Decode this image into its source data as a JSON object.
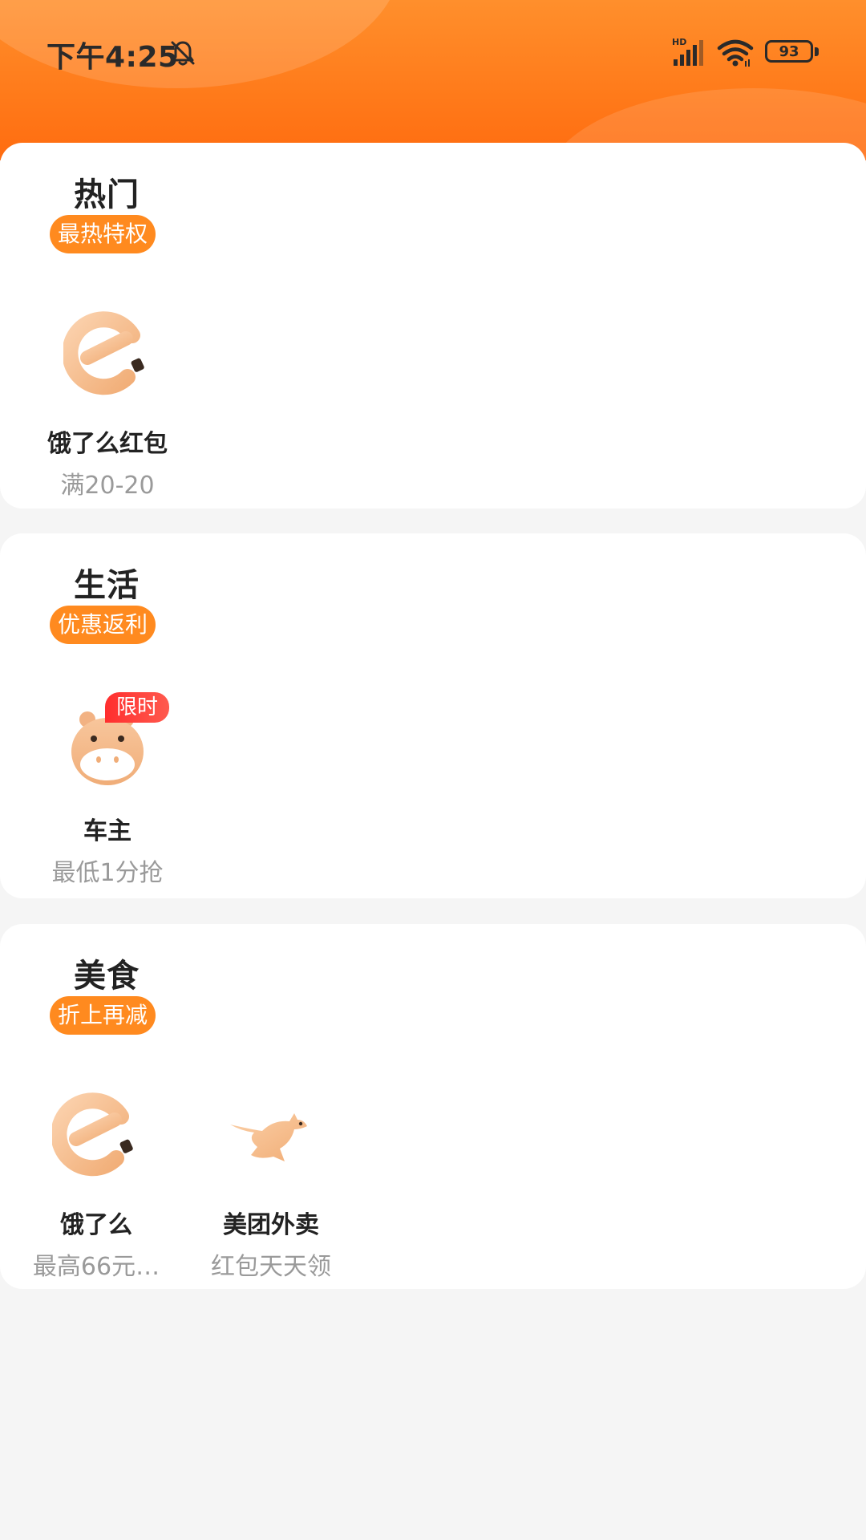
{
  "status_bar": {
    "time": "下午4:25",
    "battery": "93",
    "icons": [
      "bell-off-icon",
      "signal-hd-icon",
      "wifi-icon",
      "battery-icon"
    ]
  },
  "colors": {
    "header_orange": "#ff7a1a",
    "badge_orange": "#ff8a1f",
    "limited_red": "#ff2e2e",
    "icon_peach": "#f5b98a"
  },
  "sections": [
    {
      "title": "热门",
      "badge": "最热特权",
      "items": [
        {
          "name": "饿了么红包",
          "sub": "满20-20",
          "icon": "eleme-icon"
        }
      ]
    },
    {
      "title": "生活",
      "badge": "优惠返利",
      "items": [
        {
          "name": "车主",
          "sub": "最低1分抢",
          "icon": "hippo-icon",
          "tag": "限时"
        }
      ]
    },
    {
      "title": "美食",
      "badge": "折上再减",
      "items": [
        {
          "name": "饿了么",
          "sub": "最高66元…",
          "icon": "eleme-icon"
        },
        {
          "name": "美团外卖",
          "sub": "红包天天领",
          "icon": "kangaroo-icon"
        }
      ]
    }
  ]
}
